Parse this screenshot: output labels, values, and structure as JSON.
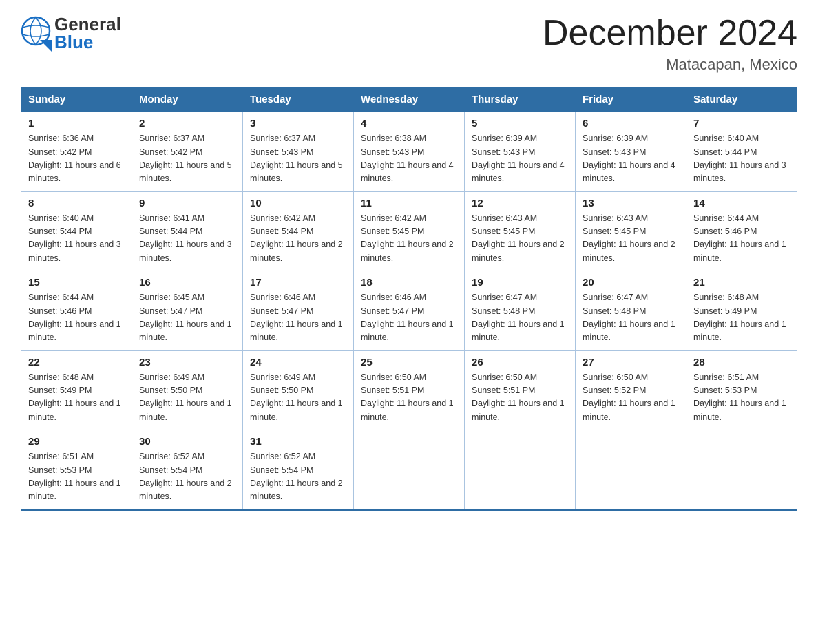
{
  "header": {
    "logo_general": "General",
    "logo_blue": "Blue",
    "month_year": "December 2024",
    "location": "Matacapan, Mexico"
  },
  "days_of_week": [
    "Sunday",
    "Monday",
    "Tuesday",
    "Wednesday",
    "Thursday",
    "Friday",
    "Saturday"
  ],
  "weeks": [
    [
      {
        "day": "1",
        "sunrise": "6:36 AM",
        "sunset": "5:42 PM",
        "daylight": "11 hours and 6 minutes."
      },
      {
        "day": "2",
        "sunrise": "6:37 AM",
        "sunset": "5:42 PM",
        "daylight": "11 hours and 5 minutes."
      },
      {
        "day": "3",
        "sunrise": "6:37 AM",
        "sunset": "5:43 PM",
        "daylight": "11 hours and 5 minutes."
      },
      {
        "day": "4",
        "sunrise": "6:38 AM",
        "sunset": "5:43 PM",
        "daylight": "11 hours and 4 minutes."
      },
      {
        "day": "5",
        "sunrise": "6:39 AM",
        "sunset": "5:43 PM",
        "daylight": "11 hours and 4 minutes."
      },
      {
        "day": "6",
        "sunrise": "6:39 AM",
        "sunset": "5:43 PM",
        "daylight": "11 hours and 4 minutes."
      },
      {
        "day": "7",
        "sunrise": "6:40 AM",
        "sunset": "5:44 PM",
        "daylight": "11 hours and 3 minutes."
      }
    ],
    [
      {
        "day": "8",
        "sunrise": "6:40 AM",
        "sunset": "5:44 PM",
        "daylight": "11 hours and 3 minutes."
      },
      {
        "day": "9",
        "sunrise": "6:41 AM",
        "sunset": "5:44 PM",
        "daylight": "11 hours and 3 minutes."
      },
      {
        "day": "10",
        "sunrise": "6:42 AM",
        "sunset": "5:44 PM",
        "daylight": "11 hours and 2 minutes."
      },
      {
        "day": "11",
        "sunrise": "6:42 AM",
        "sunset": "5:45 PM",
        "daylight": "11 hours and 2 minutes."
      },
      {
        "day": "12",
        "sunrise": "6:43 AM",
        "sunset": "5:45 PM",
        "daylight": "11 hours and 2 minutes."
      },
      {
        "day": "13",
        "sunrise": "6:43 AM",
        "sunset": "5:45 PM",
        "daylight": "11 hours and 2 minutes."
      },
      {
        "day": "14",
        "sunrise": "6:44 AM",
        "sunset": "5:46 PM",
        "daylight": "11 hours and 1 minute."
      }
    ],
    [
      {
        "day": "15",
        "sunrise": "6:44 AM",
        "sunset": "5:46 PM",
        "daylight": "11 hours and 1 minute."
      },
      {
        "day": "16",
        "sunrise": "6:45 AM",
        "sunset": "5:47 PM",
        "daylight": "11 hours and 1 minute."
      },
      {
        "day": "17",
        "sunrise": "6:46 AM",
        "sunset": "5:47 PM",
        "daylight": "11 hours and 1 minute."
      },
      {
        "day": "18",
        "sunrise": "6:46 AM",
        "sunset": "5:47 PM",
        "daylight": "11 hours and 1 minute."
      },
      {
        "day": "19",
        "sunrise": "6:47 AM",
        "sunset": "5:48 PM",
        "daylight": "11 hours and 1 minute."
      },
      {
        "day": "20",
        "sunrise": "6:47 AM",
        "sunset": "5:48 PM",
        "daylight": "11 hours and 1 minute."
      },
      {
        "day": "21",
        "sunrise": "6:48 AM",
        "sunset": "5:49 PM",
        "daylight": "11 hours and 1 minute."
      }
    ],
    [
      {
        "day": "22",
        "sunrise": "6:48 AM",
        "sunset": "5:49 PM",
        "daylight": "11 hours and 1 minute."
      },
      {
        "day": "23",
        "sunrise": "6:49 AM",
        "sunset": "5:50 PM",
        "daylight": "11 hours and 1 minute."
      },
      {
        "day": "24",
        "sunrise": "6:49 AM",
        "sunset": "5:50 PM",
        "daylight": "11 hours and 1 minute."
      },
      {
        "day": "25",
        "sunrise": "6:50 AM",
        "sunset": "5:51 PM",
        "daylight": "11 hours and 1 minute."
      },
      {
        "day": "26",
        "sunrise": "6:50 AM",
        "sunset": "5:51 PM",
        "daylight": "11 hours and 1 minute."
      },
      {
        "day": "27",
        "sunrise": "6:50 AM",
        "sunset": "5:52 PM",
        "daylight": "11 hours and 1 minute."
      },
      {
        "day": "28",
        "sunrise": "6:51 AM",
        "sunset": "5:53 PM",
        "daylight": "11 hours and 1 minute."
      }
    ],
    [
      {
        "day": "29",
        "sunrise": "6:51 AM",
        "sunset": "5:53 PM",
        "daylight": "11 hours and 1 minute."
      },
      {
        "day": "30",
        "sunrise": "6:52 AM",
        "sunset": "5:54 PM",
        "daylight": "11 hours and 2 minutes."
      },
      {
        "day": "31",
        "sunrise": "6:52 AM",
        "sunset": "5:54 PM",
        "daylight": "11 hours and 2 minutes."
      },
      null,
      null,
      null,
      null
    ]
  ],
  "labels": {
    "sunrise": "Sunrise:",
    "sunset": "Sunset:",
    "daylight": "Daylight:"
  }
}
